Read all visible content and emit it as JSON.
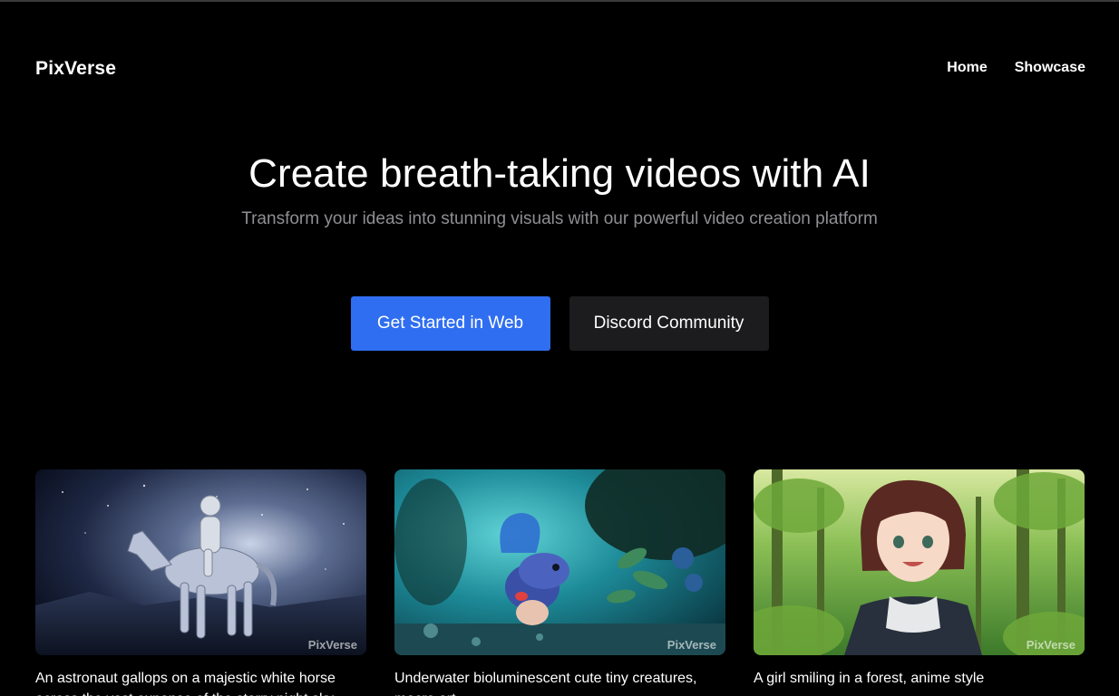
{
  "header": {
    "logo": "PixVerse",
    "nav": [
      {
        "label": "Home"
      },
      {
        "label": "Showcase"
      }
    ]
  },
  "hero": {
    "title": "Create breath-taking videos with AI",
    "subtitle": "Transform your ideas into stunning visuals with our powerful video creation platform"
  },
  "cta": {
    "primary_label": "Get Started in Web",
    "secondary_label": "Discord Community",
    "primary_color": "#2f6ef0",
    "secondary_color": "#1c1c1e"
  },
  "gallery": [
    {
      "caption": "An astronaut gallops on a majestic white horse across the vast expanse of the starry night sky",
      "watermark": "PixVerse"
    },
    {
      "caption": "Underwater bioluminescent cute tiny creatures, macro art",
      "watermark": "PixVerse"
    },
    {
      "caption": "A girl smiling in a forest, anime style",
      "watermark": "PixVerse"
    }
  ]
}
